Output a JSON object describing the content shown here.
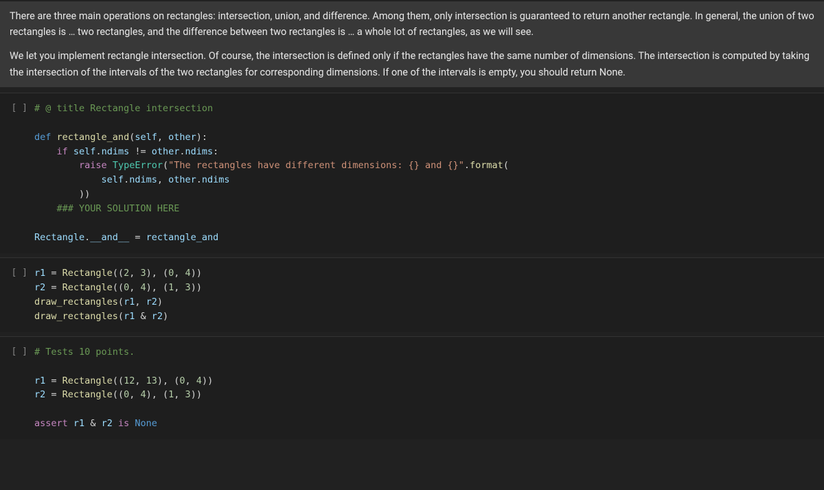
{
  "prose": {
    "p1": "There are three main operations on rectangles: intersection, union, and difference. Among them, only intersection is guaranteed to return another rectangle. In general, the union of two rectangles is … two rectangles, and the difference between two rectangles is … a whole lot of rectangles, as we will see.",
    "p2": "We let you implement rectangle intersection. Of course, the intersection is defined only if the rectangles have the same number of dimensions. The intersection is computed by taking the intersection of the intervals of the two rectangles for corresponding dimensions. If one of the intervals is empty, you should return None."
  },
  "gutter": "[ ]",
  "cell1": {
    "c_title": "# @ title Rectangle intersection",
    "kw_def": "def",
    "fn_name": "rectangle_and",
    "p_self": "self",
    "p_other": "other",
    "kw_if": "if",
    "attr_self_ndims": "self",
    "dot": ".",
    "ndims": "ndims",
    "neq": " != ",
    "other": "other",
    "colon": ":",
    "kw_raise": "raise",
    "type_err": "TypeError",
    "err_str": "\"The rectangles have different dimensions: {} and {}\"",
    "format": "format",
    "comma": ", ",
    "rparen2": "))",
    "c_yoursol": "### YOUR SOLUTION HERE",
    "rect_cls": "Rectangle",
    "dunder_and": "__and__",
    "eq": " = ",
    "fn_ref": "rectangle_and"
  },
  "cell2": {
    "r1": "r1",
    "r2": "r2",
    "eq": " = ",
    "rect": "Rectangle",
    "t2_3": "2",
    "t3": "3",
    "t0": "0",
    "t4": "4",
    "t1": "1",
    "draw": "draw_rectangles",
    "amp": " & "
  },
  "cell3": {
    "c_tests": "# Tests 10 points.",
    "r1": "r1",
    "r2": "r2",
    "eq": " = ",
    "rect": "Rectangle",
    "n12": "12",
    "n13": "13",
    "n0": "0",
    "n4": "4",
    "n1": "1",
    "n3": "3",
    "kw_assert": "assert",
    "amp": " & ",
    "kw_is": "is",
    "none": "None"
  }
}
